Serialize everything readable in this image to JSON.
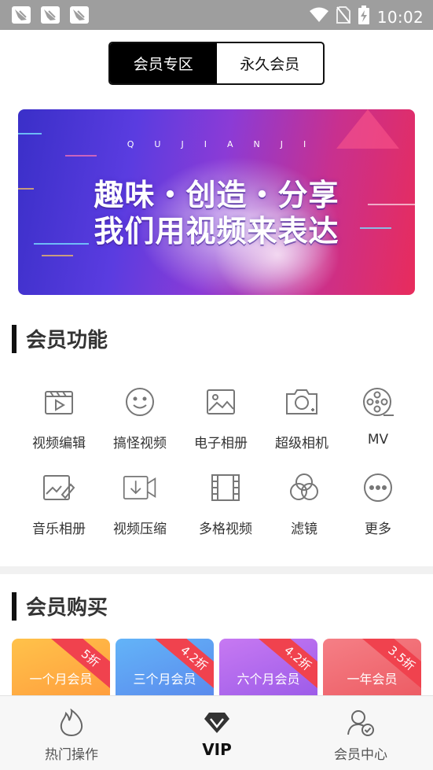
{
  "status_bar": {
    "time": "10:02",
    "notification_icons": [
      "notification-icon",
      "notification-icon",
      "notification-icon"
    ],
    "right_icons": [
      "wifi-icon",
      "no-sim-icon",
      "battery-charging-icon"
    ]
  },
  "header": {
    "tabs": [
      {
        "label": "会员专区",
        "active": true
      },
      {
        "label": "永久会员",
        "active": false
      }
    ]
  },
  "banner": {
    "letters": "QUJIANJI",
    "line1": "趣味・创造・分享",
    "line2": "我们用视频来表达"
  },
  "features_section": {
    "title": "会员功能",
    "items": [
      {
        "label": "视频编辑",
        "icon": "video-edit-icon"
      },
      {
        "label": "搞怪视频",
        "icon": "smiley-icon"
      },
      {
        "label": "电子相册",
        "icon": "photo-album-icon"
      },
      {
        "label": "超级相机",
        "icon": "camera-icon"
      },
      {
        "label": "MV",
        "icon": "film-reel-icon"
      },
      {
        "label": "音乐相册",
        "icon": "music-album-icon"
      },
      {
        "label": "视频压缩",
        "icon": "video-compress-icon"
      },
      {
        "label": "多格视频",
        "icon": "grid-video-icon"
      },
      {
        "label": "滤镜",
        "icon": "filter-icon"
      },
      {
        "label": "更多",
        "icon": "more-icon"
      }
    ]
  },
  "purchase_section": {
    "title": "会员购买",
    "cards": [
      {
        "name": "一个月会员",
        "discount": "5折",
        "color": "#fdb24a"
      },
      {
        "name": "三个月会员",
        "discount": "4.2折",
        "color": "#6aa6f5"
      },
      {
        "name": "六个月会员",
        "discount": "4.2折",
        "color": "#b86af0"
      },
      {
        "name": "一年会员",
        "discount": "3.5折",
        "color": "#f2727a"
      }
    ]
  },
  "bottom_nav": {
    "items": [
      {
        "label": "热门操作",
        "icon": "flame-icon"
      },
      {
        "label": "VIP",
        "icon": "diamond-icon",
        "active": true
      },
      {
        "label": "会员中心",
        "icon": "user-check-icon"
      }
    ]
  }
}
